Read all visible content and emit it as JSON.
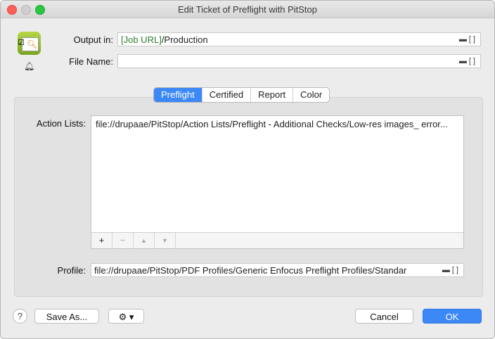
{
  "window": {
    "title": "Edit Ticket of Preflight with PitStop"
  },
  "output": {
    "label": "Output in:",
    "value_variable": "[Job URL]",
    "value_rest": "/Production",
    "folder_icon": "folder-icon",
    "bracket_icon": "bracket-icon"
  },
  "filename": {
    "label": "File Name:",
    "value": ""
  },
  "tabs": [
    {
      "label": "Preflight",
      "active": true
    },
    {
      "label": "Certified",
      "active": false
    },
    {
      "label": "Report",
      "active": false
    },
    {
      "label": "Color",
      "active": false
    }
  ],
  "action_lists": {
    "label": "Action Lists:",
    "items": [
      "file://drupaae/PitStop/Action Lists/Preflight - Additional Checks/Low-res images_ error..."
    ],
    "toolbar": {
      "add": "+",
      "remove": "−",
      "up": "▲",
      "down": "▼"
    }
  },
  "profile": {
    "label": "Profile:",
    "value": "file://drupaae/PitStop/PDF Profiles/Generic Enfocus Preflight Profiles/Standar"
  },
  "footer": {
    "help": "?",
    "save_as": "Save As...",
    "gear": "⚙ ▾",
    "cancel": "Cancel",
    "ok": "OK"
  },
  "colors": {
    "accent": "#3b88f6",
    "variable_text": "#2f7d2f"
  }
}
